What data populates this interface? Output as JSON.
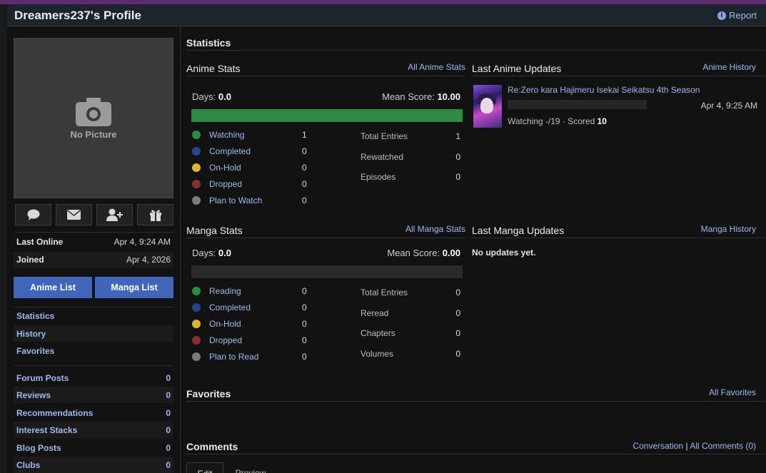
{
  "header": {
    "title": "Dreamers237's Profile",
    "report_label": "Report",
    "report_icon": "info-icon"
  },
  "sidebar": {
    "no_picture_label": "No Picture",
    "no_picture_icon": "camera-icon",
    "actions": [
      {
        "name": "message-button",
        "icon": "chat-bubble-icon"
      },
      {
        "name": "mail-button",
        "icon": "envelope-icon"
      },
      {
        "name": "add-friend-button",
        "icon": "add-user-icon"
      },
      {
        "name": "gift-button",
        "icon": "gift-icon"
      }
    ],
    "last_online_label": "Last Online",
    "last_online_value": "Apr 4, 9:24 AM",
    "joined_label": "Joined",
    "joined_value": "Apr 4, 2026",
    "anime_list_label": "Anime List",
    "manga_list_label": "Manga List",
    "nav": [
      "Statistics",
      "History",
      "Favorites"
    ],
    "counts": [
      {
        "label": "Forum Posts",
        "value": "0"
      },
      {
        "label": "Reviews",
        "value": "0"
      },
      {
        "label": "Recommendations",
        "value": "0"
      },
      {
        "label": "Interest Stacks",
        "value": "0"
      },
      {
        "label": "Blog Posts",
        "value": "0"
      },
      {
        "label": "Clubs",
        "value": "0"
      }
    ]
  },
  "statistics": {
    "title": "Statistics",
    "anime": {
      "title": "Anime Stats",
      "all_link": "All Anime Stats",
      "days_label": "Days:",
      "days_value": "0.0",
      "mean_label": "Mean Score:",
      "mean_value": "10.00",
      "progress_fraction": 1.0,
      "legend": [
        {
          "label": "Watching",
          "value": "1",
          "color": "#2e8b43"
        },
        {
          "label": "Completed",
          "value": "0",
          "color": "#26448f"
        },
        {
          "label": "On-Hold",
          "value": "0",
          "color": "#e1b42b"
        },
        {
          "label": "Dropped",
          "value": "0",
          "color": "#8e2f2f"
        },
        {
          "label": "Plan to Watch",
          "value": "0",
          "color": "#7a7a7a"
        }
      ],
      "totals": [
        {
          "label": "Total Entries",
          "value": "1"
        },
        {
          "label": "Rewatched",
          "value": "0"
        },
        {
          "label": "Episodes",
          "value": "0"
        }
      ]
    },
    "manga": {
      "title": "Manga Stats",
      "all_link": "All Manga Stats",
      "days_label": "Days:",
      "days_value": "0.0",
      "mean_label": "Mean Score:",
      "mean_value": "0.00",
      "progress_fraction": 0.0,
      "legend": [
        {
          "label": "Reading",
          "value": "0",
          "color": "#2e8b43"
        },
        {
          "label": "Completed",
          "value": "0",
          "color": "#26448f"
        },
        {
          "label": "On-Hold",
          "value": "0",
          "color": "#e1b42b"
        },
        {
          "label": "Dropped",
          "value": "0",
          "color": "#8e2f2f"
        },
        {
          "label": "Plan to Read",
          "value": "0",
          "color": "#7a7a7a"
        }
      ],
      "totals": [
        {
          "label": "Total Entries",
          "value": "0"
        },
        {
          "label": "Reread",
          "value": "0"
        },
        {
          "label": "Chapters",
          "value": "0"
        },
        {
          "label": "Volumes",
          "value": "0"
        }
      ]
    }
  },
  "anime_updates": {
    "title": "Last Anime Updates",
    "history_link": "Anime History",
    "entry_title": "Re:Zero kara Hajimeru Isekai Seikatsu 4th Season",
    "entry_time": "Apr 4, 9:25 AM",
    "entry_status": "Watching -/19 · Scored",
    "entry_score": "10"
  },
  "manga_updates": {
    "title": "Last Manga Updates",
    "history_link": "Manga History",
    "empty_text": "No updates yet."
  },
  "favorites": {
    "title": "Favorites",
    "all_link": "All Favorites"
  },
  "comments": {
    "title": "Comments",
    "conversation_link": "Conversation",
    "separator": "|",
    "all_link": "All Comments (0)",
    "edit_tab": "Edit",
    "preview_tab": "Preview"
  }
}
